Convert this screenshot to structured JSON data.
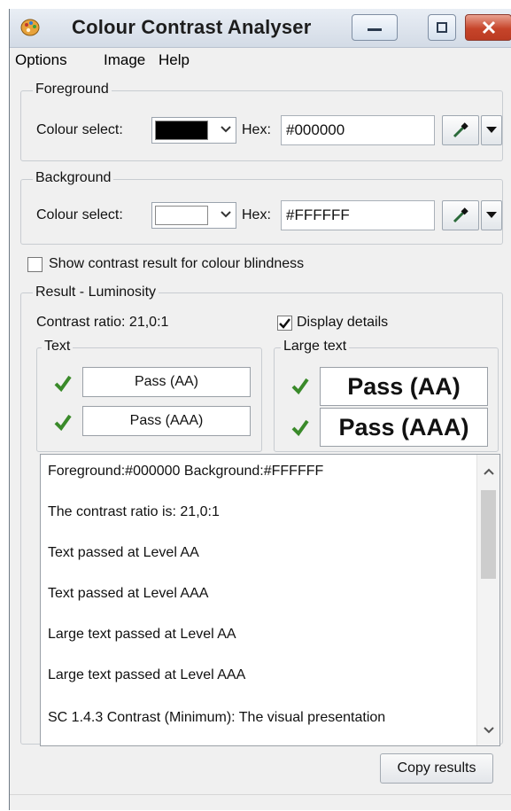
{
  "window": {
    "title": "Colour Contrast Analyser"
  },
  "menu": [
    "Options",
    "Image",
    "Help"
  ],
  "foreground": {
    "group_title": "Foreground",
    "colour_label": "Colour select:",
    "swatch_color": "#000000",
    "hex_label": "Hex:",
    "hex_value": "#000000"
  },
  "background": {
    "group_title": "Background",
    "colour_label": "Colour select:",
    "swatch_color": "#FFFFFF",
    "hex_label": "Hex:",
    "hex_value": "#FFFFFF"
  },
  "colour_blindness": {
    "label": "Show contrast result for colour blindness",
    "checked": false
  },
  "result": {
    "group_title": "Result - Luminosity",
    "contrast_ratio": "Contrast ratio: 21,0:1",
    "display_details": {
      "label": "Display details",
      "checked": true
    },
    "text": {
      "title": "Text",
      "aa": "Pass (AA)",
      "aaa": "Pass (AAA)"
    },
    "large_text": {
      "title": "Large text",
      "aa": "Pass (AA)",
      "aaa": "Pass (AAA)"
    }
  },
  "details": [
    "Foreground:#000000  Background:#FFFFFF",
    "The contrast ratio is: 21,0:1",
    "Text passed at Level AA",
    "Text passed at Level AAA",
    "Large text passed at Level AA",
    "Large text passed at Level AAA",
    "SC 1.4.3 Contrast (Minimum): The visual presentation"
  ],
  "copy_button": "Copy results",
  "colors": {
    "pass_tick": "#3a8a2a",
    "window_bg": "#f0f0f0",
    "close_red": "#c6442a"
  }
}
